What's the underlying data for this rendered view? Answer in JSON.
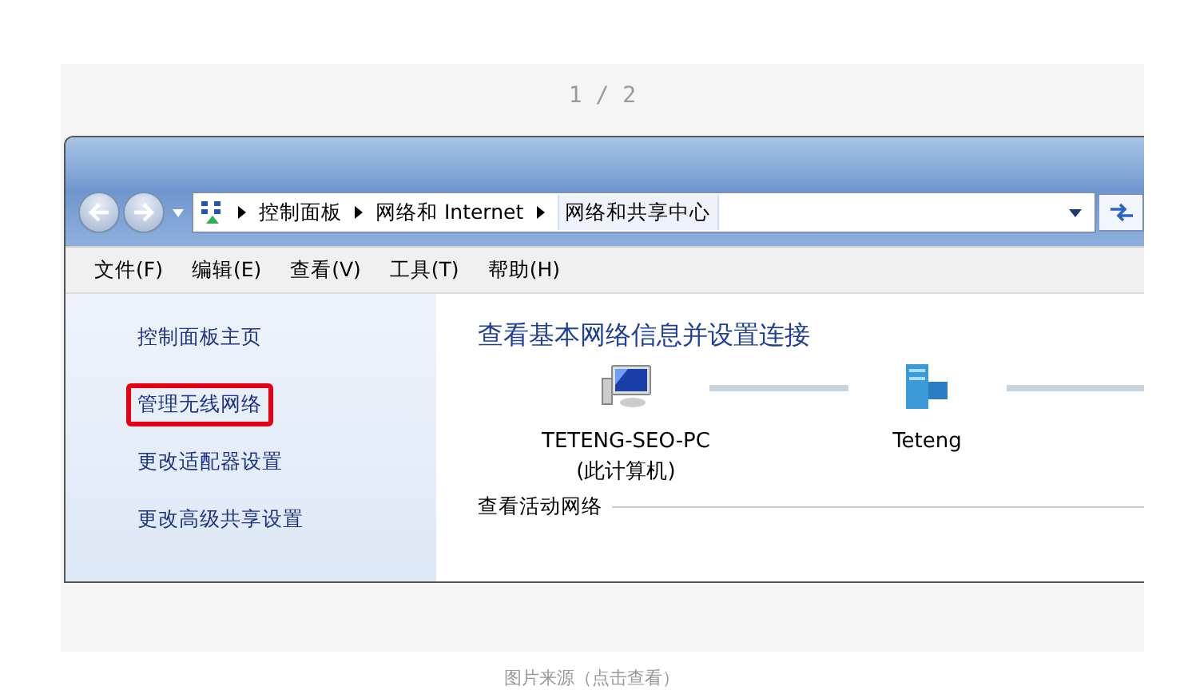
{
  "viewer": {
    "counter": "1 / 2",
    "caption": "图片来源（点击查看）"
  },
  "address_bar": {
    "crumbs": [
      "控制面板",
      "网络和 Internet",
      "网络和共享中心"
    ]
  },
  "menu": [
    "文件(F)",
    "编辑(E)",
    "查看(V)",
    "工具(T)",
    "帮助(H)"
  ],
  "sidebar": {
    "items": [
      {
        "label": "控制面板主页",
        "highlighted": false
      },
      {
        "label": "管理无线网络",
        "highlighted": true
      },
      {
        "label": "更改适配器设置",
        "highlighted": false
      },
      {
        "label": "更改高级共享设置",
        "highlighted": false
      }
    ]
  },
  "main": {
    "heading": "查看基本网络信息并设置连接",
    "nodes": [
      {
        "kind": "computer",
        "name": "TETENG-SEO-PC",
        "sub": "(此计算机)"
      },
      {
        "kind": "network",
        "name": "Teteng"
      }
    ],
    "section": "查看活动网络"
  }
}
